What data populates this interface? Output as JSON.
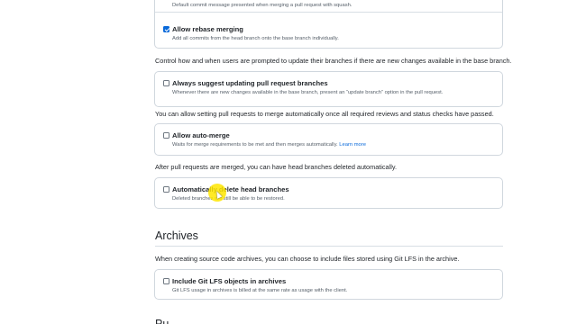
{
  "squash_option": {
    "description": "Default commit message presented when merging a pull request with squash."
  },
  "rebase_option": {
    "checked": true,
    "title": "Allow rebase merging",
    "description": "Add all commits from the head branch onto the base branch individually."
  },
  "update_branch_intro": "Control how and when users are prompted to update their branches if there are new changes available in the base branch.",
  "update_branch_option": {
    "checked": false,
    "title": "Always suggest updating pull request branches",
    "description": "Whenever there are new changes available in the base branch, present an “update branch” option in the pull request."
  },
  "auto_merge_intro": "You can allow setting pull requests to merge automatically once all required reviews and status checks have passed.",
  "auto_merge_option": {
    "checked": false,
    "title": "Allow auto-merge",
    "description": "Waits for merge requirements to be met and then merges automatically.",
    "learn_more": "Learn more"
  },
  "delete_branch_intro": "After pull requests are merged, you can have head branches deleted automatically.",
  "delete_branch_option": {
    "checked": false,
    "title": "Automatically delete head branches",
    "description": "Deleted branches will still be able to be restored."
  },
  "archives": {
    "heading": "Archives",
    "intro": "When creating source code archives, you can choose to include files stored using Git LFS in the archive.",
    "lfs_option": {
      "checked": false,
      "title": "Include Git LFS objects in archives",
      "description": "Git LFS usage in archives is billed at the same rate as usage with the client."
    }
  },
  "next_heading_partial": "Pu"
}
